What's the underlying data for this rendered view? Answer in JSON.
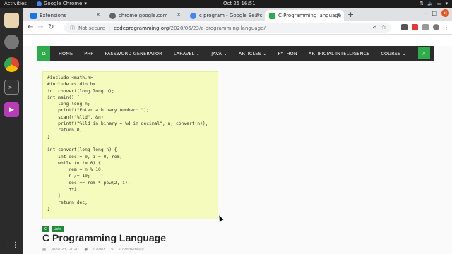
{
  "topbar": {
    "activities": "Activities",
    "app_name": "Google Chrome",
    "clock": "Oct 25  16:51"
  },
  "tabs": [
    {
      "label": "Extensions",
      "icon": "puzzle-icon",
      "active": false
    },
    {
      "label": "chrome.google.com",
      "icon": "globe-icon",
      "active": false
    },
    {
      "label": "c program - Google Searc",
      "icon": "google-icon",
      "active": false
    },
    {
      "label": "C Programming language",
      "icon": "site-icon",
      "active": true
    }
  ],
  "toolbar": {
    "security": "Not secure",
    "url_host": "codeprogramming.org",
    "url_path": "/2020/06/23/c-programming-language/"
  },
  "sitenav": {
    "items": [
      "HOME",
      "PHP",
      "PASSWORD GENERATOR",
      "LARAVEL ⌄",
      "JAVA ⌄",
      "ARTICLES ⌄",
      "PYTHON",
      "ARTIFICIAL INTELLIGENCE",
      "COURSE ⌄"
    ]
  },
  "code": {
    "lines": [
      "#include <math.h>",
      "#include <stdio.h>",
      "int convert(long long n);",
      "int main() {",
      "    long long n;",
      "    printf(\"Enter a binary number: \");",
      "    scanf(\"%lld\", &n);",
      "    printf(\"%lld in binary = %d in decimal\", n, convert(n));",
      "    return 0;",
      "}",
      "",
      "int convert(long long n) {",
      "    int dec = 0, i = 0, rem;",
      "    while (n != 0) {",
      "        rem = n % 10;",
      "        n /= 10;",
      "        dec += rem * pow(2, i);",
      "        ++i;",
      "    }",
      "    return dec;",
      "}"
    ]
  },
  "post": {
    "badges": [
      "C",
      "Lists"
    ],
    "title": "C Programming Language",
    "date": "June 23, 2020",
    "author": "Coder",
    "comments": "Comment(0)"
  },
  "colors": {
    "accent": "#2eab4a",
    "nav_bg": "#2c2c2c",
    "code_bg": "#f5fbbd"
  }
}
